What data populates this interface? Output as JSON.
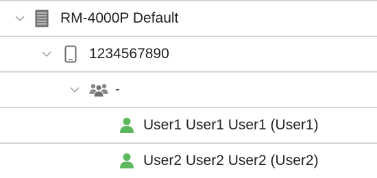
{
  "tree": {
    "nodes": [
      {
        "label": "RM-4000P Default",
        "icon": "server-icon",
        "expanded": true,
        "level": 0
      },
      {
        "label": "1234567890",
        "icon": "mobile-device-icon",
        "expanded": true,
        "level": 1
      },
      {
        "label": "-",
        "icon": "user-group-icon",
        "expanded": true,
        "level": 2
      },
      {
        "label": "User1 User1 User1 (User1)",
        "icon": "user-icon",
        "level": 3
      },
      {
        "label": "User2 User2 User2 (User2)",
        "icon": "user-icon",
        "level": 3
      }
    ],
    "colors": {
      "user_icon": "#5cb85c",
      "group_icon": "#8a8a8a",
      "device_icon": "#6a6a6a",
      "chevron": "#9a9a9a",
      "divider": "#d4d4d4"
    }
  }
}
